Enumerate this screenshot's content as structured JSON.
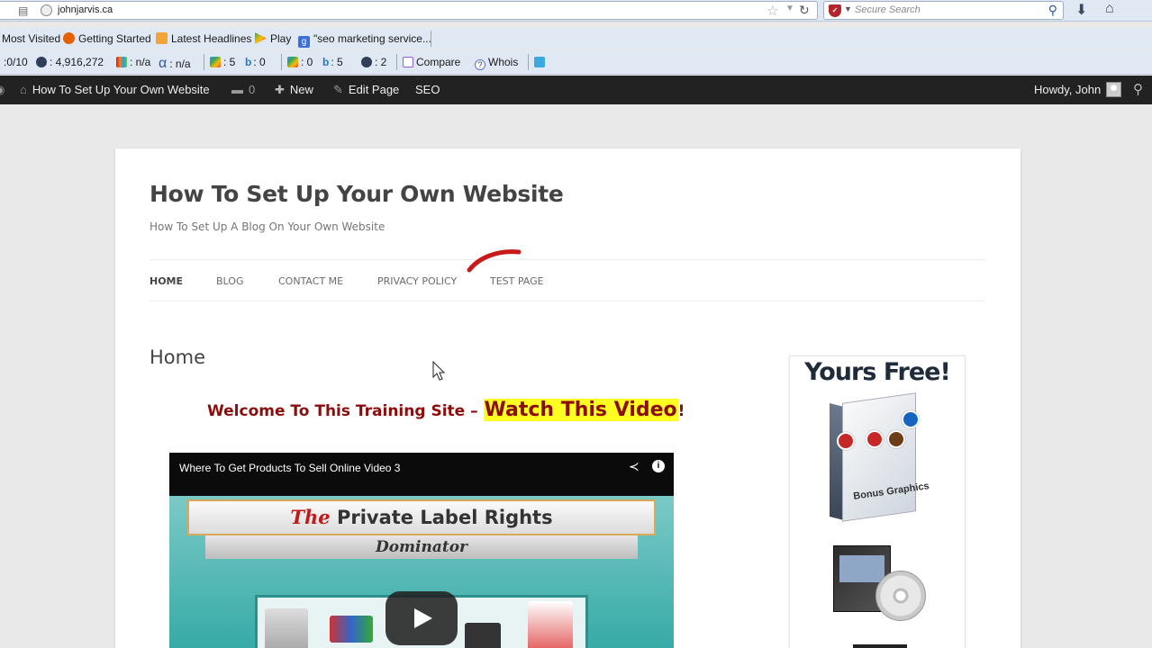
{
  "browser": {
    "url": "johnjarvis.ca",
    "search_placeholder": "Secure Search"
  },
  "bookmarks": [
    {
      "label": "Most Visited",
      "icon": "most-visited-icon"
    },
    {
      "label": "Getting Started",
      "icon": "firefox-icon"
    },
    {
      "label": "Latest Headlines",
      "icon": "rss-icon"
    },
    {
      "label": "Play",
      "icon": "play-icon"
    },
    {
      "label": "\"seo marketing service...",
      "icon": "google-icon"
    }
  ],
  "seo_toolbar": {
    "pagerank": ":0/10",
    "alexa": ": 4,916,272",
    "metric_a": ": n/a",
    "metric_b": ": n/a",
    "google_index_1": ": 5",
    "bing_index_1": ": 0",
    "google_index_2": ": 0",
    "bing_index_2": ": 5",
    "info_count": ": 2",
    "compare": "Compare",
    "whois": "Whois"
  },
  "admin_bar": {
    "site_name": "How To Set Up Your Own Website",
    "comments": "0",
    "new": "New",
    "edit_page": "Edit Page",
    "seo": "SEO",
    "howdy": "Howdy, John"
  },
  "site": {
    "title": "How To Set Up Your Own Website",
    "description": "How To Set Up A Blog On Your Own Website"
  },
  "nav": [
    {
      "label": "HOME",
      "active": true
    },
    {
      "label": "BLOG",
      "active": false
    },
    {
      "label": "CONTACT ME",
      "active": false
    },
    {
      "label": "PRIVACY POLICY",
      "active": false
    },
    {
      "label": "TEST PAGE",
      "active": false
    }
  ],
  "content": {
    "page_title": "Home",
    "welcome_prefix": "Welcome To This Training Site – ",
    "welcome_highlight": "Watch This Video",
    "welcome_suffix": "!"
  },
  "video": {
    "title": "Where To Get Products To Sell Online Video 3",
    "banner_the": "The",
    "banner_main": " Private Label Rights",
    "banner_sub": "Dominator"
  },
  "sidebar_ad": {
    "title": "Yours Free!",
    "box_label": "Bonus Graphics"
  },
  "colors": {
    "welcome_text": "#8b0d0d",
    "highlight": "#ffff22",
    "admin_bar": "#222222",
    "chrome": "#dfe8f3"
  }
}
